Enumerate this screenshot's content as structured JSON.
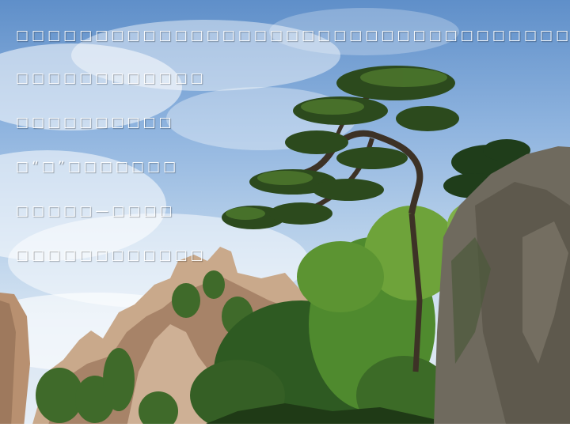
{
  "slide": {
    "paragraph": "□□□□□□□□□□□□□□□□□□□□□□□□□□□□□□□□□□□□□□□□□□□□□□□□□□□□□□□□□□□□□□□□□",
    "lines": [
      "□□□□□□□□□□□□",
      "□□□□□□□□□□",
      "□“□”□□□□□□□",
      "□□□□□—□□□□",
      "□□□□□□□□□□□□"
    ]
  }
}
